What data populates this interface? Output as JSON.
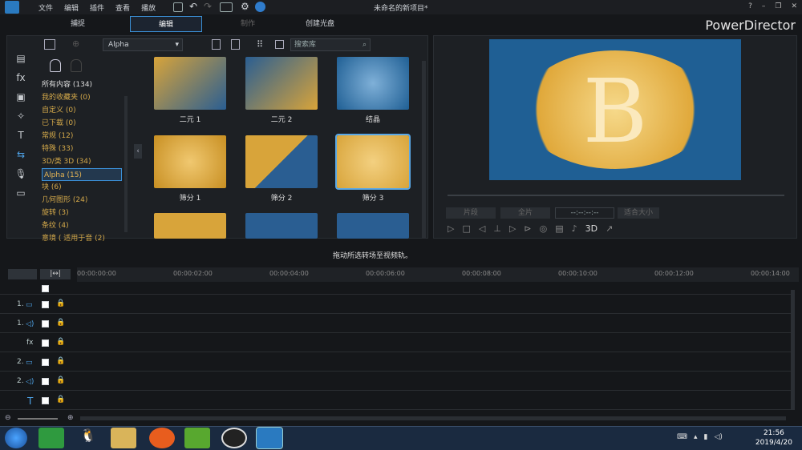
{
  "app": {
    "title": "未命名的新项目*",
    "brand": "PowerDirector"
  },
  "menu": [
    "文件",
    "编辑",
    "插件",
    "查看",
    "播放"
  ],
  "modes": [
    {
      "label": "捕捉"
    },
    {
      "label": "编辑"
    },
    {
      "label": "制作"
    },
    {
      "label": "创建光盘"
    }
  ],
  "library": {
    "filter_value": "Alpha",
    "search_placeholder": "搜索库",
    "categories": [
      "所有内容 (134)",
      "我的收藏夹 (0)",
      "自定义 (0)",
      "已下载 (0)",
      "常规 (12)",
      "特殊 (33)",
      "3D/类 3D (34)",
      "Alpha (15)",
      "块 (6)",
      "几何图形 (24)",
      "旋转 (3)",
      "条纹 (4)",
      "意境 ( 适用于音 (2)"
    ],
    "tiles": [
      "二元 1",
      "二元 2",
      "结晶",
      "筛分 1",
      "筛分 2",
      "筛分 3"
    ]
  },
  "preview": {
    "buttons": [
      "片段",
      "全片"
    ],
    "timecode": "--:--:--:--",
    "fit": "适合大小",
    "three_d": "3D"
  },
  "hint": "拖动所选转场至视频轨。",
  "ruler": [
    "00:00:00:00",
    "00:00:02:00",
    "00:00:04:00",
    "00:00:06:00",
    "00:00:08:00",
    "00:00:10:00",
    "00:00:12:00",
    "00:00:14:00"
  ],
  "tracks": [
    "1.",
    "1.",
    "fx",
    "2.",
    "2.",
    "T"
  ],
  "taskbar": {
    "time": "21:56",
    "date": "2019/4/20"
  }
}
